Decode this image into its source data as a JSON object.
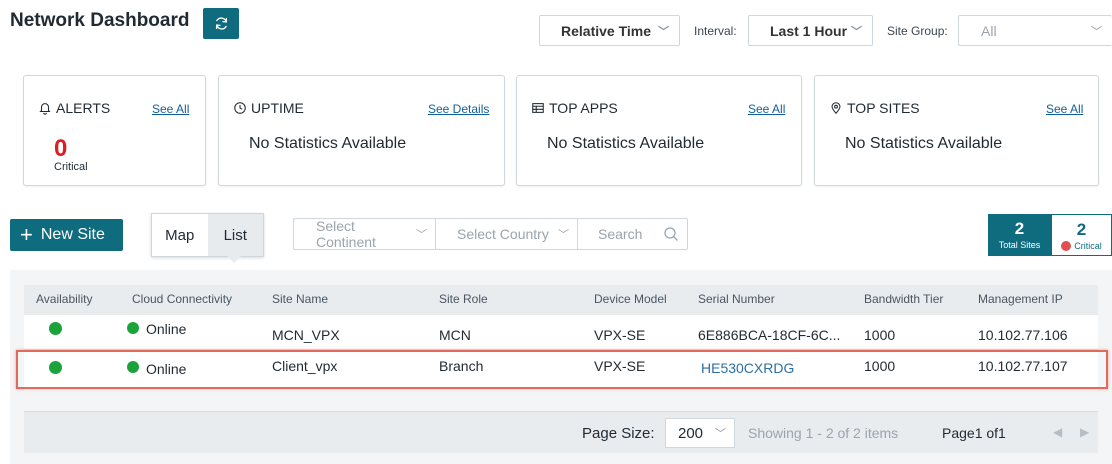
{
  "header": {
    "title": "Network Dashboard",
    "time_mode": "Relative Time",
    "interval_label": "Interval:",
    "interval_value": "Last 1 Hour",
    "site_group_label": "Site Group:",
    "site_group_value": "All"
  },
  "cards": {
    "alerts": {
      "title": "ALERTS",
      "link": "See All",
      "count": "0",
      "sub": "Critical"
    },
    "uptime": {
      "title": "UPTIME",
      "link": "See Details",
      "body": "No Statistics Available"
    },
    "top_apps": {
      "title": "TOP APPS",
      "link": "See All",
      "body": "No Statistics Available"
    },
    "top_sites": {
      "title": "TOP SITES",
      "link": "See All",
      "body": "No Statistics Available"
    }
  },
  "toolbar": {
    "new_site": "New Site",
    "view_map": "Map",
    "view_list": "List",
    "active_view": "List",
    "continent_placeholder": "Select Continent",
    "country_placeholder": "Select Country",
    "search_placeholder": "Search"
  },
  "stats": {
    "total_count": "2",
    "total_label": "Total Sites",
    "critical_count": "2",
    "critical_label": "Critical"
  },
  "table": {
    "columns": [
      "Availability",
      "Cloud Connectivity",
      "Site Name",
      "Site Role",
      "Device Model",
      "Serial Number",
      "Bandwidth Tier",
      "Management IP"
    ],
    "rows": [
      {
        "connectivity": "Online",
        "site_name": "MCN_VPX",
        "site_role": "MCN",
        "device_model": "VPX-SE",
        "serial": "6E886BCA-18CF-6C...",
        "bandwidth": "1000",
        "ip": "10.102.77.106"
      },
      {
        "connectivity": "Online",
        "site_name": "Client_vpx",
        "site_role": "Branch",
        "device_model": "VPX-SE",
        "serial": "HE530CXRDG",
        "bandwidth": "1000",
        "ip": "10.102.77.107"
      }
    ]
  },
  "pager": {
    "size_label": "Page Size:",
    "size_value": "200",
    "showing": "Showing 1 - 2 of 2 items",
    "page": "Page1 of1"
  },
  "colors": {
    "accent": "#0f6b7e",
    "alert_red": "#e01b22",
    "online_green": "#1aa33a",
    "highlight": "#e06a5c"
  }
}
